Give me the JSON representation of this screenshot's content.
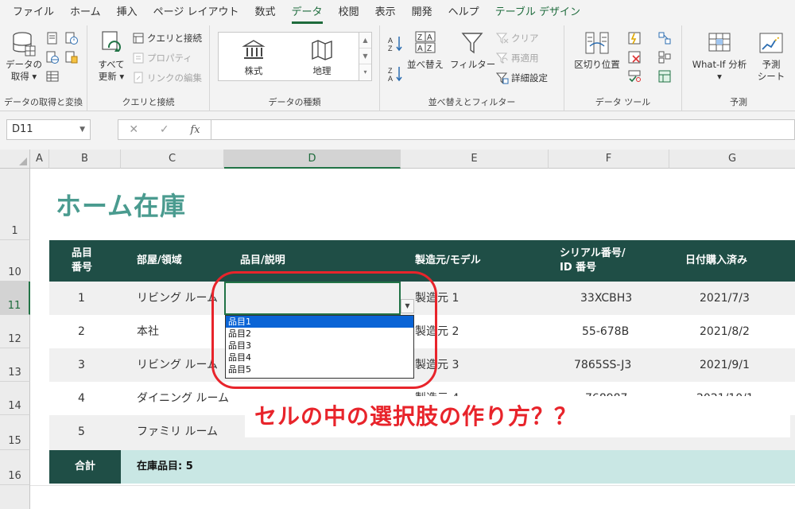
{
  "ribbon": {
    "tabs": [
      "ファイル",
      "ホーム",
      "挿入",
      "ページ レイアウト",
      "数式",
      "データ",
      "校閲",
      "表示",
      "開発",
      "ヘルプ",
      "テーブル デザイン"
    ],
    "active_tab": "データ",
    "groups": {
      "get_data": {
        "label": "データの取得と変換",
        "get_data_button": "データの\n取得 ▾"
      },
      "queries": {
        "label": "クエリと接続",
        "refresh_all": "すべて\n更新 ▾",
        "queries_connections": "クエリと接続",
        "properties": "プロパティ",
        "edit_links": "リンクの編集"
      },
      "data_types": {
        "label": "データの種類",
        "stocks": "株式",
        "geography": "地理"
      },
      "sort_filter": {
        "label": "並べ替えとフィルター",
        "sort": "並べ替え",
        "filter": "フィルター",
        "clear": "クリア",
        "reapply": "再適用",
        "advanced": "詳細設定"
      },
      "data_tools": {
        "label": "データ ツール",
        "text_to_columns": "区切り位置"
      },
      "forecast": {
        "label": "予測",
        "what_if": "What-If 分析\n▾",
        "forecast_sheet": "予測\nシート"
      }
    }
  },
  "formula_bar": {
    "name_box": "D11",
    "fx": "fx"
  },
  "columns": [
    "A",
    "B",
    "C",
    "D",
    "E",
    "F",
    "G"
  ],
  "rows": [
    "1",
    "10",
    "11",
    "12",
    "13",
    "14",
    "15",
    "16"
  ],
  "sheet": {
    "title": "ホーム在庫",
    "headers": {
      "item_no": "品目\n番号",
      "room": "部屋/領域",
      "item": "品目/説明",
      "maker": "製造元/モデル",
      "serial": "シリアル番号/\nID 番号",
      "date": "日付購入済み"
    },
    "data_rows": [
      {
        "no": "1",
        "room": "リビング ルーム",
        "maker": "製造元 1",
        "serial": "33XCBH3",
        "date": "2021/7/3"
      },
      {
        "no": "2",
        "room": "本社",
        "maker": "製造元 2",
        "serial": "55-678B",
        "date": "2021/8/2"
      },
      {
        "no": "3",
        "room": "リビング ルーム",
        "maker": "製造元 3",
        "serial": "7865SS-J3",
        "date": "2021/9/1"
      },
      {
        "no": "4",
        "room": "ダイニング ルーム",
        "maker": "製造元 4",
        "serial": "768987",
        "date": "2021/10/1"
      },
      {
        "no": "5",
        "room": "ファミリ ルーム",
        "maker": "",
        "serial": "",
        "date": ""
      }
    ],
    "total_label": "合計",
    "total_text": "在庫品目: 5"
  },
  "dropdown": {
    "options": [
      "品目1",
      "品目2",
      "品目3",
      "品目4",
      "品目5"
    ],
    "selected_index": 0
  },
  "annotation": "セルの中の選択肢の作り方？？",
  "colors": {
    "accent": "#217346",
    "header_bg": "#1f4e46",
    "title": "#4a9b8f",
    "total_bg": "#c9e7e4",
    "annotation": "#e8242b",
    "selection": "#0a64d6"
  }
}
